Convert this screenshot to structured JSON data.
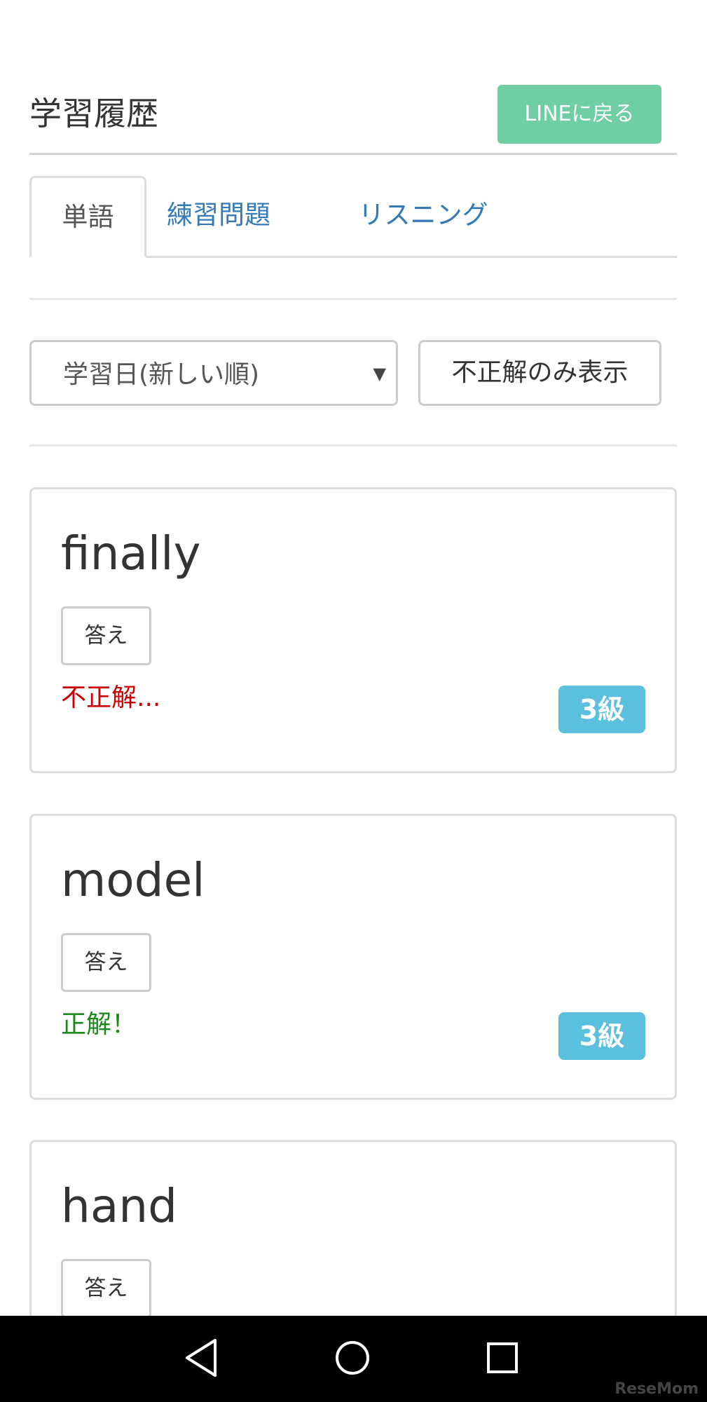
{
  "header": {
    "title": "学習履歴",
    "back_button": "LINEに戻る"
  },
  "tabs": [
    {
      "label": "単語",
      "active": true
    },
    {
      "label": "練習問題",
      "active": false
    },
    {
      "label": "リスニング",
      "active": false
    }
  ],
  "filters": {
    "sort_value": "学習日(新しい順)",
    "filter_button": "不正解のみ表示"
  },
  "cards": [
    {
      "word": "finally",
      "answer_button": "答え",
      "result": "不正解...",
      "result_status": "wrong",
      "grade": "3級"
    },
    {
      "word": "model",
      "answer_button": "答え",
      "result": "正解！",
      "result_status": "correct",
      "grade": "3級"
    },
    {
      "word": "hand",
      "answer_button": "答え"
    }
  ],
  "nav_bar": {
    "icons": [
      "back-icon",
      "home-icon",
      "recent-apps-icon"
    ]
  },
  "watermark": "ReseMom",
  "colors": {
    "line_green": "#6fcfa3",
    "badge_blue": "#5bc0de",
    "link_blue": "#337ab7",
    "wrong_red": "#cc0000",
    "correct_green": "#1a8a1a"
  }
}
